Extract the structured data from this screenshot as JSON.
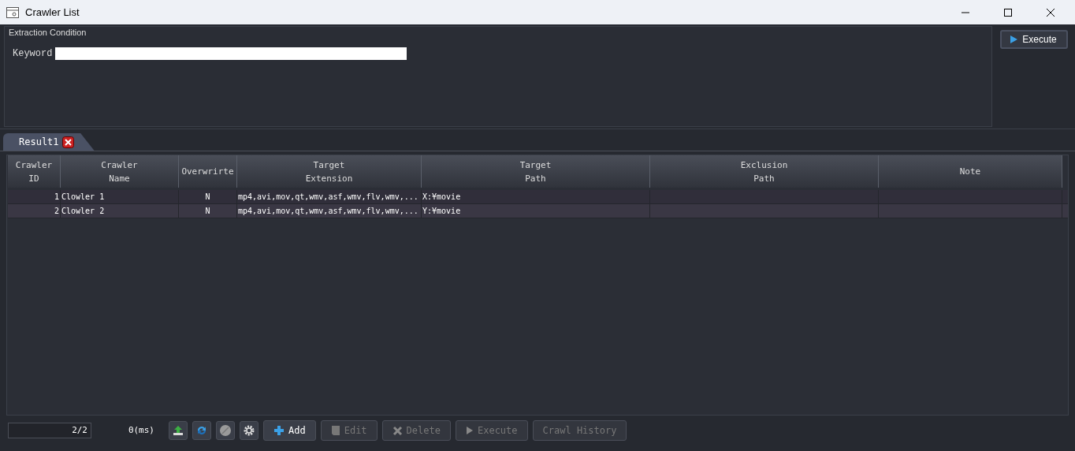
{
  "window": {
    "title": "Crawler List"
  },
  "condition": {
    "title": "Extraction Condition",
    "keyword_label": "Keyword"
  },
  "execute_button": {
    "label": "Execute"
  },
  "tabs": [
    {
      "label": "Result1",
      "selected": true
    }
  ],
  "table": {
    "columns": [
      "Crawler\nID",
      "Crawler\nName",
      "Overwrirte",
      "Target\nExtension",
      "Target\nPath",
      "Exclusion\nPath",
      "Note"
    ],
    "rows": [
      [
        "1",
        "Clowler 1",
        "N",
        "mp4,avi,mov,qt,wmv,asf,wmv,flv,wmv,...",
        "X:¥movie",
        "",
        ""
      ],
      [
        "2",
        "Clowler 2",
        "N",
        "mp4,avi,mov,qt,wmv,asf,wmv,flv,wmv,...",
        "Y:¥movie",
        "",
        ""
      ]
    ]
  },
  "status": {
    "count": "2/2",
    "time": "0(ms)"
  },
  "tools": [
    {
      "kind": "export"
    },
    {
      "kind": "refresh"
    },
    {
      "kind": "stop"
    },
    {
      "kind": "settings"
    }
  ],
  "buttons": [
    {
      "kind": "add",
      "label": "Add",
      "disabled": false
    },
    {
      "kind": "edit",
      "label": "Edit",
      "disabled": true
    },
    {
      "kind": "delete",
      "label": "Delete",
      "disabled": true
    },
    {
      "kind": "execute",
      "label": "Execute",
      "disabled": true
    },
    {
      "kind": "history",
      "label": "Crawl History",
      "disabled": true
    }
  ]
}
